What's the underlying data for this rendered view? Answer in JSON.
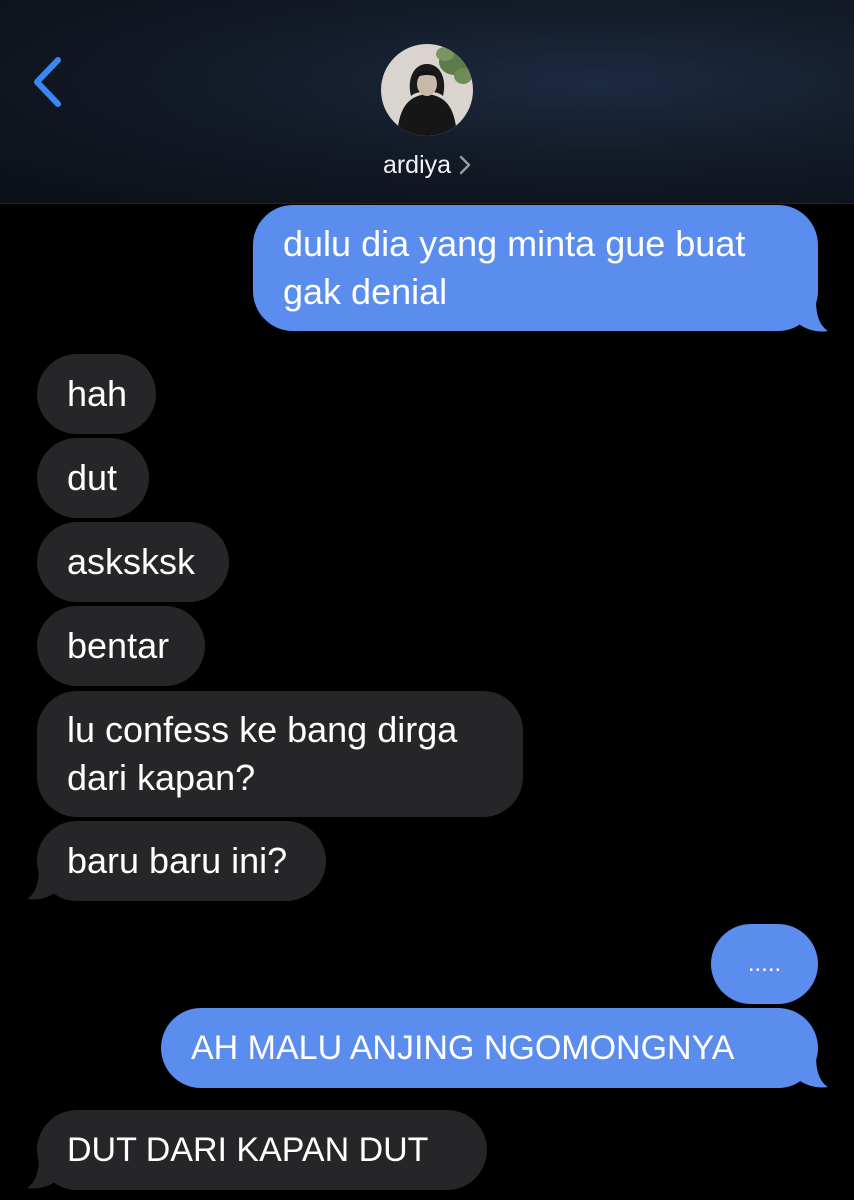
{
  "header": {
    "back_icon": "chevron-left-icon",
    "contact_name": "ardiya",
    "contact_chevron": "chevron-right-icon",
    "accent_color": "#3a86f5"
  },
  "colors": {
    "sent_bubble": "#5b8def",
    "received_bubble": "#262629",
    "background": "#000000"
  },
  "messages": [
    {
      "from": "me",
      "text": "dulu dia yang minta gue buat\ngak denial"
    },
    {
      "from": "them",
      "text": "hah"
    },
    {
      "from": "them",
      "text": "dut"
    },
    {
      "from": "them",
      "text": "asksksk"
    },
    {
      "from": "them",
      "text": "bentar"
    },
    {
      "from": "them",
      "text": "lu confess ke bang dirga\ndari kapan?"
    },
    {
      "from": "them",
      "text": "baru baru ini?"
    },
    {
      "from": "me",
      "text": "....."
    },
    {
      "from": "me",
      "text": "AH MALU ANJING NGOMONGNYA"
    },
    {
      "from": "them",
      "text": "DUT DARI KAPAN DUT"
    }
  ]
}
